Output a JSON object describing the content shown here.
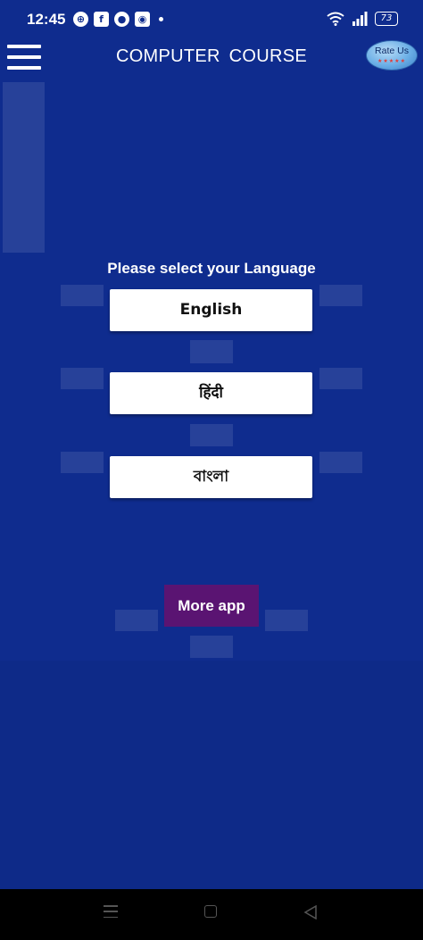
{
  "status_bar": {
    "time": "12:45",
    "icons": [
      "grid-icon",
      "facebook-icon",
      "app-icon",
      "app-icon",
      "dot-icon"
    ],
    "battery": "73"
  },
  "header": {
    "title": "COMPUTER  COURSE",
    "rate_us": {
      "label": "Rate Us",
      "stars": "★★★★★"
    }
  },
  "main": {
    "prompt": "Please select your Language",
    "languages": [
      {
        "label": "English"
      },
      {
        "label": "हिंदी"
      },
      {
        "label": "বাংলা"
      }
    ],
    "more_app_label": "More app"
  },
  "colors": {
    "background": "#0f2c8e",
    "button": "#ffffff",
    "more_app": "#5a1472",
    "nav_bar": "#000000"
  }
}
